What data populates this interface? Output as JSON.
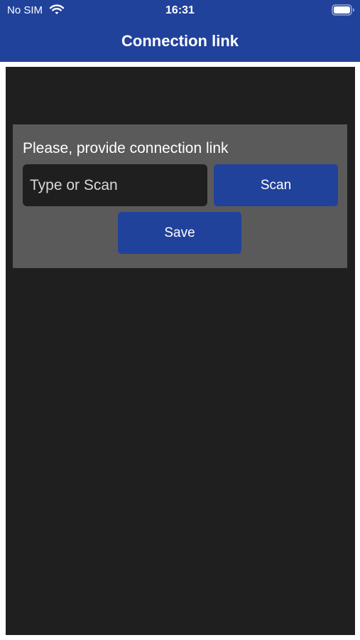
{
  "status_bar": {
    "carrier": "No SIM",
    "time": "16:31"
  },
  "nav": {
    "title": "Connection link"
  },
  "form": {
    "prompt": "Please, provide connection link",
    "link_value": "",
    "link_placeholder": "Type or Scan",
    "scan_label": "Scan",
    "save_label": "Save"
  },
  "colors": {
    "brand_blue": "#21429b",
    "panel_gray": "#5a5a5a",
    "background_dark": "#1f1f1f"
  }
}
